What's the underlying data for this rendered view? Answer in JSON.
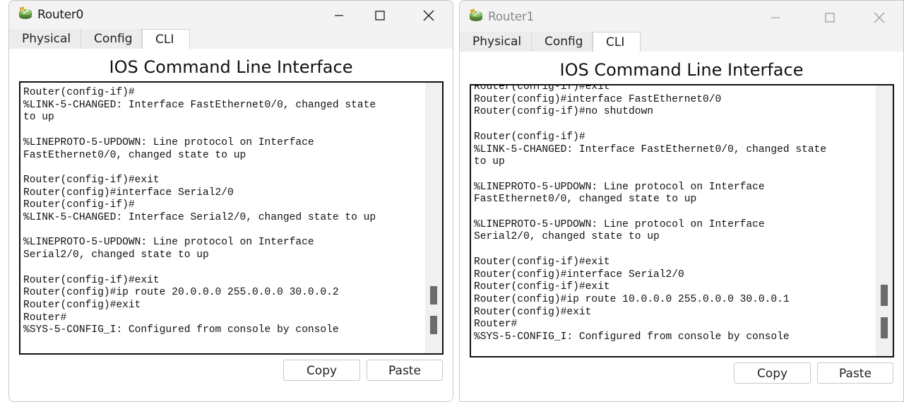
{
  "windows": [
    {
      "title": "Router0",
      "tabs": [
        "Physical",
        "Config",
        "CLI"
      ],
      "active_tab": "CLI",
      "heading": "IOS Command Line Interface",
      "console": "Router(config-if)#\n%LINK-5-CHANGED: Interface FastEthernet0/0, changed state\nto up\n\n%LINEPROTO-5-UPDOWN: Line protocol on Interface\nFastEthernet0/0, changed state to up\n\nRouter(config-if)#exit\nRouter(config)#interface Serial2/0\nRouter(config-if)#\n%LINK-5-CHANGED: Interface Serial2/0, changed state to up\n\n%LINEPROTO-5-UPDOWN: Line protocol on Interface\nSerial2/0, changed state to up\n\nRouter(config-if)#exit\nRouter(config)#ip route 20.0.0.0 255.0.0.0 30.0.0.2\nRouter(config)#exit\nRouter#\n%SYS-5-CONFIG_I: Configured from console by console",
      "buttons": {
        "copy": "Copy",
        "paste": "Paste"
      }
    },
    {
      "title": "Router1",
      "tabs": [
        "Physical",
        "Config",
        "CLI"
      ],
      "active_tab": "CLI",
      "heading": "IOS Command Line Interface",
      "console": "Router(config-if)#exit\nRouter(config)#interface FastEthernet0/0\nRouter(config-if)#no shutdown\n\nRouter(config-if)#\n%LINK-5-CHANGED: Interface FastEthernet0/0, changed state\nto up\n\n%LINEPROTO-5-UPDOWN: Line protocol on Interface\nFastEthernet0/0, changed state to up\n\n%LINEPROTO-5-UPDOWN: Line protocol on Interface\nSerial2/0, changed state to up\n\nRouter(config-if)#exit\nRouter(config)#interface Serial2/0\nRouter(config-if)#exit\nRouter(config)#ip route 10.0.0.0 255.0.0.0 30.0.0.1\nRouter(config)#exit\nRouter#\n%SYS-5-CONFIG_I: Configured from console by console",
      "buttons": {
        "copy": "Copy",
        "paste": "Paste"
      }
    }
  ],
  "icons": {
    "app": "router-icon",
    "minimize": "minimize-icon",
    "maximize": "maximize-icon",
    "close": "close-icon"
  }
}
